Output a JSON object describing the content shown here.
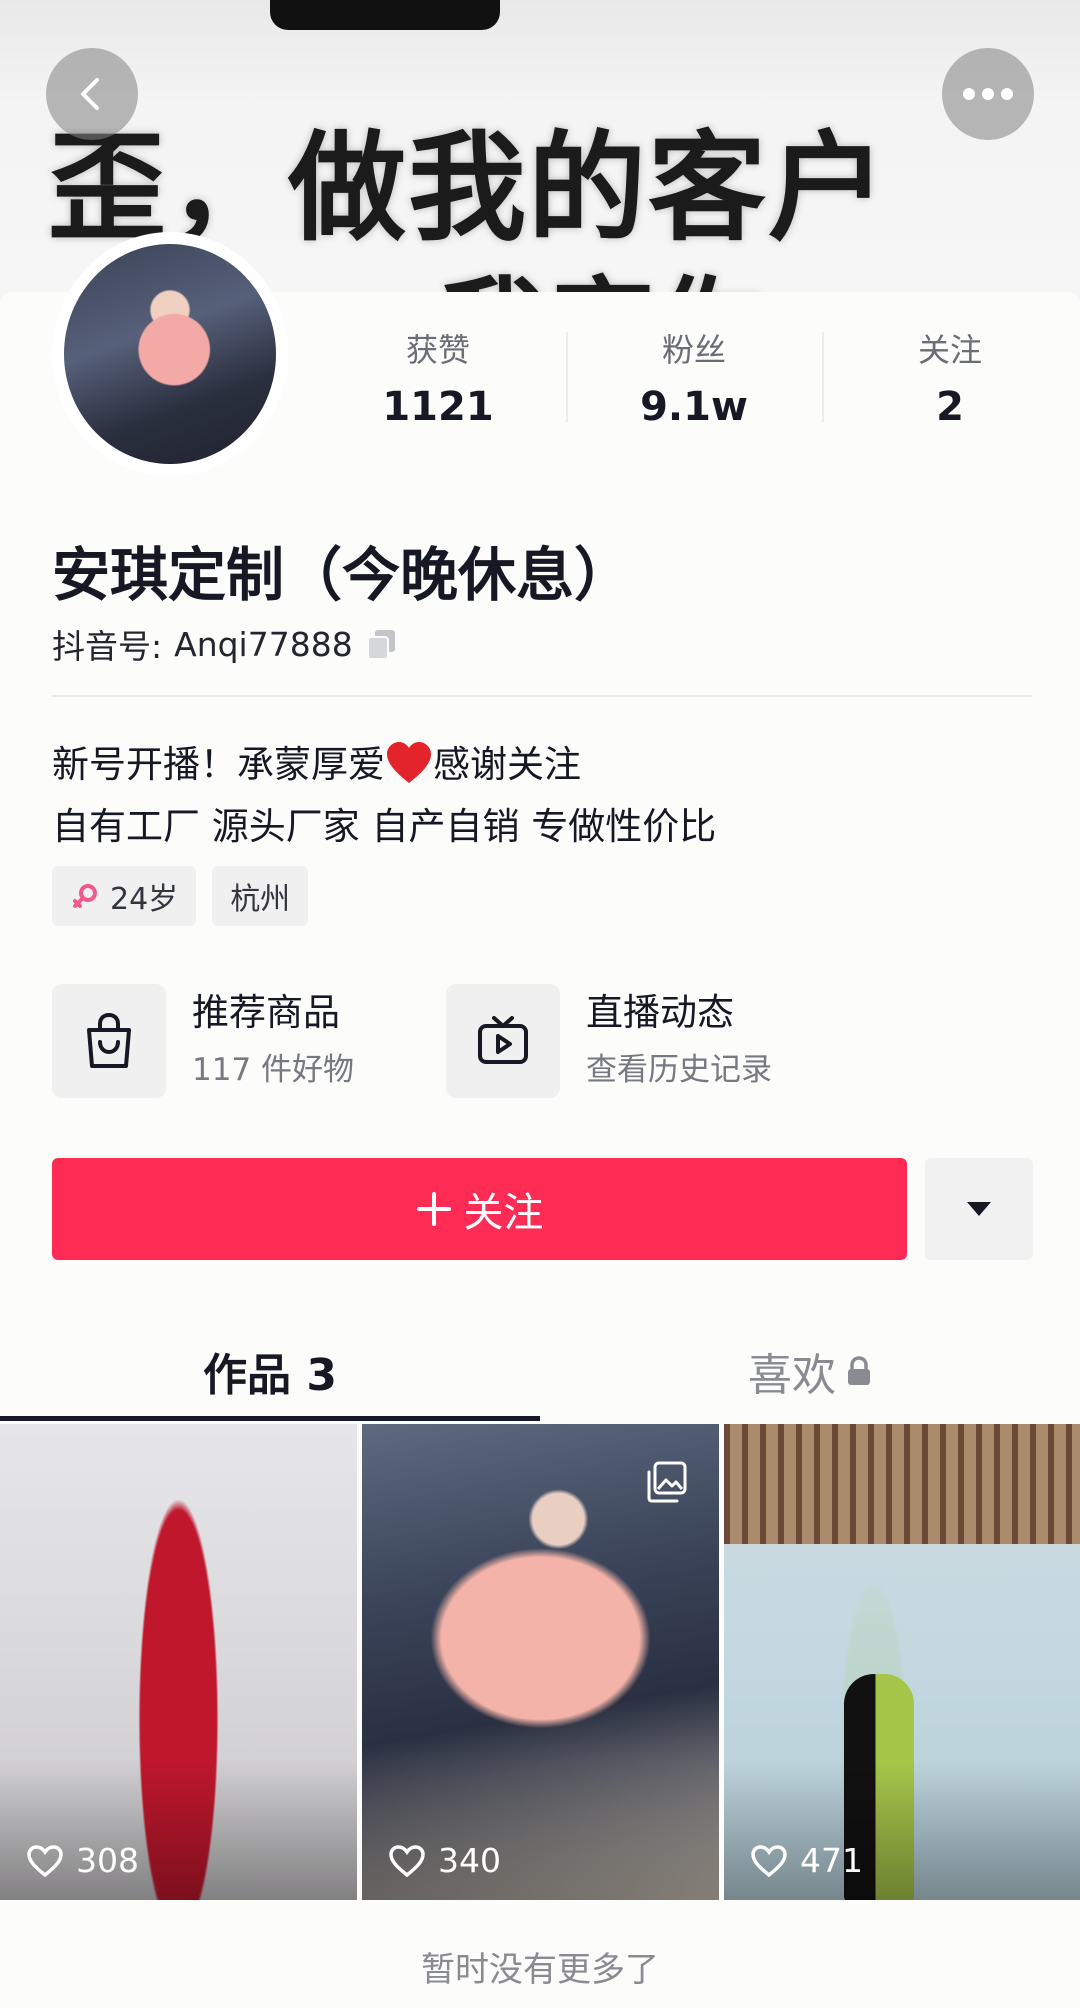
{
  "banner": {
    "line1": "歪，做我的客户",
    "line2": "我宠你"
  },
  "profile": {
    "name": "安琪定制（今晚休息）",
    "douyin_id_label": "抖音号:",
    "douyin_id": "Anqi77888",
    "stats": [
      {
        "label": "获赞",
        "value": "1121"
      },
      {
        "label": "粉丝",
        "value": "9.1w"
      },
      {
        "label": "关注",
        "value": "2"
      }
    ],
    "bio_line1_a": "新号开播！承蒙厚爱",
    "bio_line1_b": "感谢关注",
    "bio_line2": "自有工厂 源头厂家 自产自销 专做性价比",
    "tags": {
      "age": "24岁",
      "city": "杭州"
    }
  },
  "shortcuts": [
    {
      "title": "推荐商品",
      "sub": "117 件好物",
      "icon": "shopping-bag-icon"
    },
    {
      "title": "直播动态",
      "sub": "查看历史记录",
      "icon": "tv-play-icon"
    }
  ],
  "actions": {
    "follow_label": "关注",
    "follow_prefix": "+"
  },
  "tabs": {
    "works_label": "作品 3",
    "likes_label": "喜欢"
  },
  "videos": [
    {
      "likes": "308"
    },
    {
      "likes": "340"
    },
    {
      "likes": "471"
    }
  ],
  "footer": {
    "text": "暂时没有更多了"
  },
  "colors": {
    "accent": "#fe2c55",
    "text": "#161823",
    "muted": "#8a8b91"
  }
}
